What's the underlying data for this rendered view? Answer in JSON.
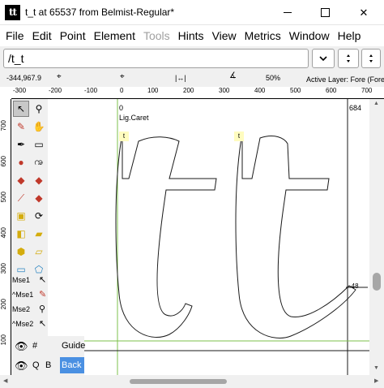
{
  "window": {
    "title": "t_t at 65537 from Belmist-Regular*",
    "app_icon_text": "tt",
    "minimize": "minimize",
    "maximize": "maximize",
    "close": "✕"
  },
  "menu": [
    {
      "label": "File",
      "disabled": false
    },
    {
      "label": "Edit",
      "disabled": false
    },
    {
      "label": "Point",
      "disabled": false
    },
    {
      "label": "Element",
      "disabled": false
    },
    {
      "label": "Tools",
      "disabled": true
    },
    {
      "label": "Hints",
      "disabled": false
    },
    {
      "label": "View",
      "disabled": false
    },
    {
      "label": "Metrics",
      "disabled": false
    },
    {
      "label": "Window",
      "disabled": false
    },
    {
      "label": "Help",
      "disabled": false
    }
  ],
  "glyph_bar": {
    "name_value": "/t_t",
    "dropdown_icon": "chevron-down-icon",
    "button1_icon": "up-down-icon",
    "button2_icon": "up-down-icon"
  },
  "info": {
    "coords": "-344,967.9",
    "zoom": "50%",
    "active_layer": "Active Layer: Fore (Fore)"
  },
  "ruler": {
    "top_ticks": [
      "-300",
      "-200",
      "-100",
      "0",
      "100",
      "200",
      "300",
      "400",
      "500",
      "600",
      "700"
    ],
    "left_ticks": [
      "700",
      "600",
      "500",
      "400",
      "300",
      "200",
      "100"
    ]
  },
  "canvas": {
    "origin_label": "0",
    "caret_label": "Lig.Caret",
    "advance_label": "684",
    "anchor1": "t",
    "anchor2": "t",
    "kern_label": "-48"
  },
  "mouse": {
    "rows": [
      "Mse1",
      "^Mse1",
      "Mse2",
      "^Mse2"
    ]
  },
  "layers": [
    {
      "q": "#",
      "b": "",
      "name": "Guide",
      "active": false
    },
    {
      "q": "Q",
      "b": "B",
      "name": "Back",
      "active": true
    }
  ],
  "colors": {
    "guideline": "#7ec04b",
    "outline": "#1a1a1a",
    "anchor_bg": "#fffcbf",
    "layer_active": "#4a90e2"
  }
}
